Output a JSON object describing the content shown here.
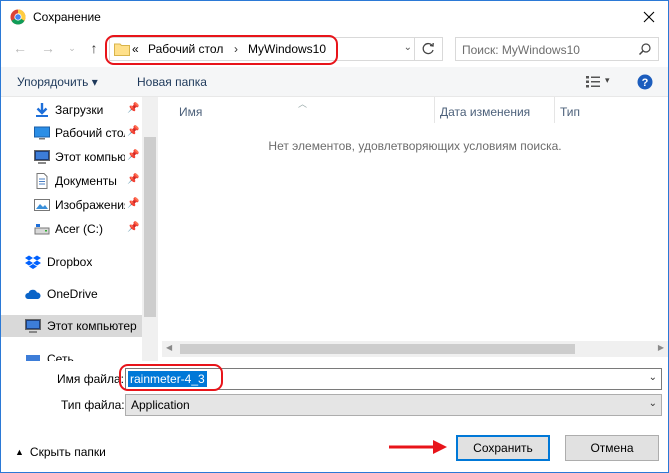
{
  "window": {
    "title": "Сохранение"
  },
  "nav": {
    "address_parts": [
      "«",
      "Рабочий стол",
      "MyWindows10"
    ],
    "search_placeholder": "Поиск: MyWindows10"
  },
  "toolbar": {
    "organize_label": "Упорядочить ▾",
    "new_folder_label": "Новая папка"
  },
  "sidebar": {
    "items": [
      {
        "label": "Загрузки",
        "icon": "download-icon"
      },
      {
        "label": "Рабочий стол",
        "icon": "desktop-icon"
      },
      {
        "label": "Этот компьютер",
        "icon": "computer-icon"
      },
      {
        "label": "Документы",
        "icon": "documents-icon"
      },
      {
        "label": "Изображения",
        "icon": "pictures-icon"
      },
      {
        "label": "Acer (C:)",
        "icon": "drive-icon"
      },
      {
        "label": "Dropbox",
        "icon": "dropbox-icon"
      },
      {
        "label": "OneDrive",
        "icon": "onedrive-icon"
      },
      {
        "label": "Этот компьютер",
        "icon": "computer-icon"
      },
      {
        "label": "Сеть",
        "icon": "network-icon"
      }
    ]
  },
  "columns": {
    "name": "Имя",
    "date": "Дата изменения",
    "type": "Тип"
  },
  "empty_message": "Нет элементов, удовлетворяющих условиям поиска.",
  "form": {
    "filename_label": "Имя файла:",
    "filename_value": "rainmeter-4_3",
    "filetype_label": "Тип файла:",
    "filetype_value": "Application"
  },
  "footer": {
    "hide_folders_label": "Скрыть папки",
    "save_label": "Сохранить",
    "cancel_label": "Отмена"
  },
  "colors": {
    "accent": "#0078d7",
    "highlight": "#e8141a"
  }
}
